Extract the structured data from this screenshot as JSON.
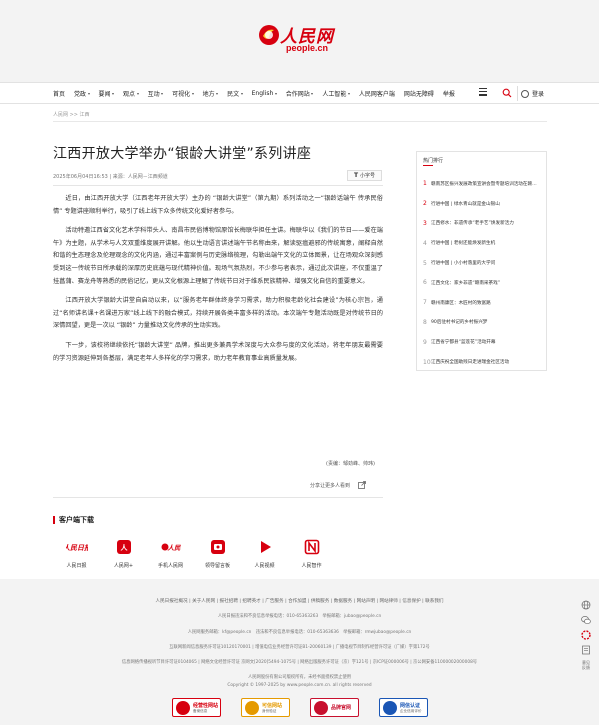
{
  "header": {
    "logo_text": "人民网",
    "logo_domain": "people.cn"
  },
  "nav": {
    "items": [
      {
        "label": "首页",
        "caret": false
      },
      {
        "label": "党政",
        "caret": true
      },
      {
        "label": "要闻",
        "caret": true
      },
      {
        "label": "观点",
        "caret": true
      },
      {
        "label": "互动",
        "caret": true
      },
      {
        "label": "可视化",
        "caret": true
      },
      {
        "label": "地方",
        "caret": true
      },
      {
        "label": "民文",
        "caret": true
      },
      {
        "label": "English",
        "caret": true
      },
      {
        "label": "合作网站",
        "caret": true
      },
      {
        "label": "人工智能",
        "caret": true
      },
      {
        "label": "人民网客户端",
        "caret": false
      },
      {
        "label": "网站无障碍",
        "caret": false
      },
      {
        "label": "举报",
        "caret": false
      }
    ],
    "login_label": "登录"
  },
  "breadcrumb": "人民网 >> 江西",
  "article": {
    "title": "江西开放大学举办“银龄大讲堂”系列讲座",
    "meta": "2025年06月04日16:53 | 来源：人民网－江西频道",
    "font_button": "小字号",
    "paragraphs": [
      "近日，由江西开放大学（江西老年开放大学）主办的 “银龄大讲堂”（第九期）系列活动之一“银龄话端午 传承民俗情” 专题讲座顺利举行，吸引了线上线下众多传统文化爱好者参与。",
      "活动特邀江西省文化艺术学科带头人、南昌市民俗博物馆原馆长梅联华担任主讲。梅联华以《我们的节日——爱在端午》为主题，从学术与人文双重维度展开讲解。他以生动语言讲述端午节名称由来，解读驱瘟避邪的传统寓意，阐释自然和谐的生态理念及伦理观念的文化内涵，通过丰富案例与历史脉络梳理，勾勒出端午文化的立体图景，让在场观众深刻感受到这一传统节日所承载的深厚历史底蕴与现代精神价值。现场气氛热烈，不少参与者表示，通过此次讲座，不仅重温了挂菖蒲、赛龙舟等熟悉的民俗记忆，更从文化根源上理解了传统节日对于维系民族精神、增强文化自信的重要意义。",
      "江西开放大学银龄大讲堂自启动以来，以“服务老年群体终身学习需求，助力积极老龄化社会建设”为核心宗旨，通过“名师讲名课+名课进万家”线上线下的融合模式，持续开展各类丰富多样的活动。本次端午专题活动既是对传统节日的深情回望，更是一次以 “银龄” 力量推动文化传承的生动实践。",
      "下一步，该校将继续依托“银龄大讲堂” 品牌，推出更多兼具学术深度与大众参与度的文化活动，将老年朋友最需要的学习资源延伸到各基层，满足老年人多样化的学习需求，助力老年教育事业高质量发展。"
    ],
    "editor": "(责编：邹劲峰、帅玮)",
    "share_label": "分享让更多人看到"
  },
  "client": {
    "title": "客户端下载",
    "apps": [
      {
        "label": "人民日报",
        "icon": "people-daily-icon",
        "color": "#d7000f"
      },
      {
        "label": "人民网+",
        "icon": "people-plus-icon",
        "color": "#d7000f"
      },
      {
        "label": "手机人民网",
        "icon": "mobile-people-icon",
        "color": "#d7000f"
      },
      {
        "label": "领导留言板",
        "icon": "leader-board-icon",
        "color": "#d7000f"
      },
      {
        "label": "人民视频",
        "icon": "people-video-icon",
        "color": "#d7000f"
      },
      {
        "label": "人民智作",
        "icon": "people-zhizuo-icon",
        "color": "#d7000f"
      }
    ]
  },
  "hot": {
    "title": "热门排行",
    "items": [
      "赣南苏区振兴发展政策宣讲会暨专题培训活动在赣州举行",
      "行进中国 | 绿水青山就是金山银山",
      "江西修水：非遗传承“老手艺”焕发新活力",
      "行进中国 | 老树还能焕发新生机",
      "行进中国 | 小小村落里的大学问",
      "江西文化：家乡非遗“赣南采茶戏”",
      "赣州南康区：木匠村的致富路",
      "90后驻村书记的乡村振兴梦",
      "江西省宁都县“蓝莲花”活动开幕",
      "江西庆祝全国助残日走进瑞金社区活动"
    ]
  },
  "side_tools": {
    "label": "意见反馈"
  },
  "footer": {
    "links": "人民日报社概况 | 关于人民网 | 报社招聘 | 招聘英才 | 广告服务 | 合作加盟 | 供稿服务 | 数据服务 | 网站声明 | 网站律师 | 信息保护 | 联系我们",
    "lines": [
      "人民日报违法和不良信息举报电话：010-65363263　举报邮箱：jubao@people.cn",
      "人民网服务邮箱：kf@people.cn　违法和不良信息举报电话：010-65363636　举报邮箱：rmwjubao@people.cn",
      "互联网新闻信息服务许可证10120170001 | 增值电信业务经营许可证B1-20060139 | 广播电视节目制作经营许可证（广媒）字第172号",
      "信息网络传播视听节目许可证0104065 | 网络文化经营许可证 京网文[2020]5494-1075号 | 网络出版服务许可证（京）字121号 | 京ICP证000006号 | 京公网安备11000002000008号",
      "人民网股份有限公司版权所有，未经书面授权禁止使用",
      "Copyright © 1997-2025 by www.people.com.cn. all rights reserved"
    ],
    "badges": [
      {
        "title": "经营性网站",
        "sub": "备案信息",
        "color": "#d7000f"
      },
      {
        "title": "可信网站",
        "sub": "身份验证",
        "color": "#e59a00"
      },
      {
        "title": "品牌官网",
        "sub": "",
        "color": "#c8102e"
      },
      {
        "title": "网信认证",
        "sub": "企业信用评价",
        "color": "#1a56b5"
      }
    ]
  }
}
